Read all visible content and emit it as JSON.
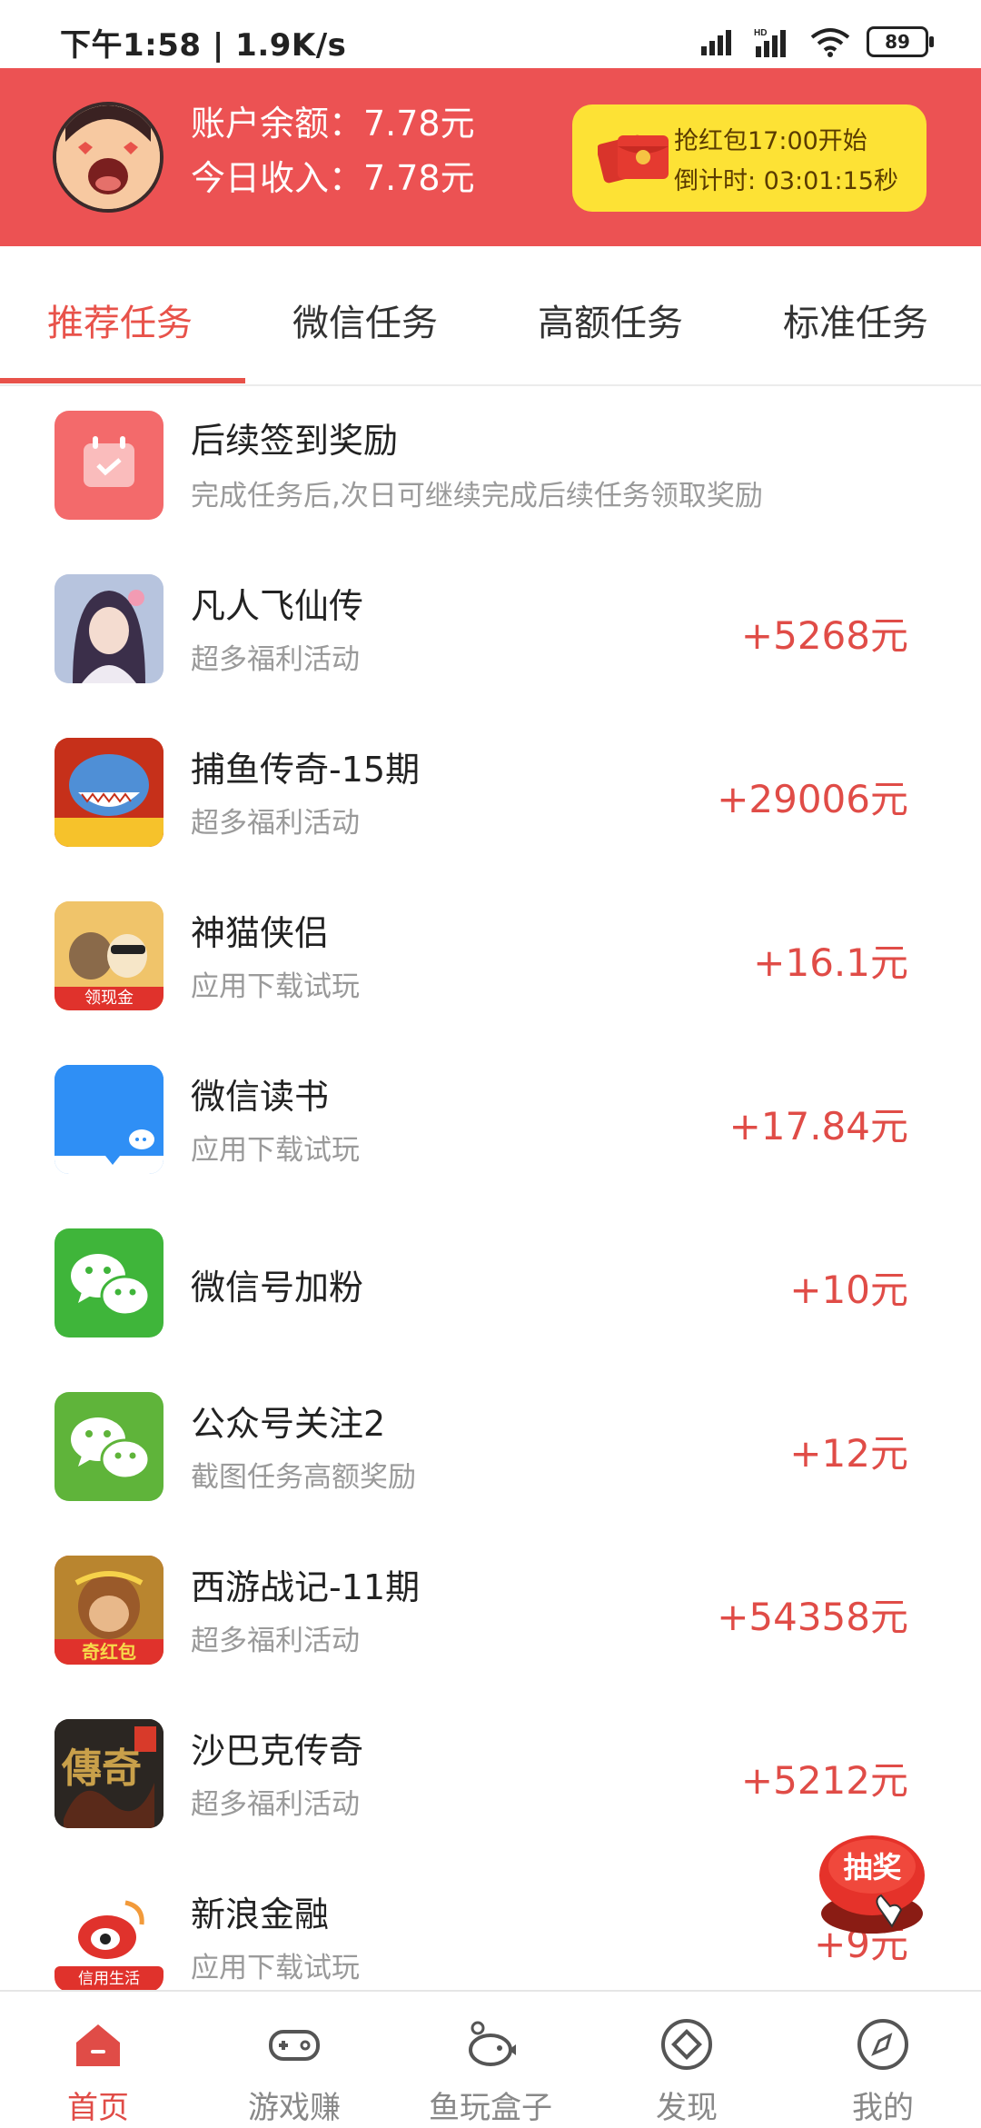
{
  "status_bar": {
    "time_speed": "下午1:58 | 1.9K/s",
    "battery": "89"
  },
  "header": {
    "balance": "账户余额：7.78元",
    "income": "今日收入：7.78元",
    "redpacket": {
      "start": "抢红包17:00开始",
      "countdown": "倒计时: 03:01:15秒"
    }
  },
  "tabs": [
    {
      "label": "推荐任务",
      "active": true
    },
    {
      "label": "微信任务"
    },
    {
      "label": "高额任务"
    },
    {
      "label": "标准任务"
    }
  ],
  "tasks": [
    {
      "title": "后续签到奖励",
      "subtitle": "完成任务后,次日可继续完成后续任务领取奖励",
      "reward": "",
      "icon": "calendar-check-icon"
    },
    {
      "title": "凡人飞仙传",
      "subtitle": "超多福利活动",
      "reward": "+5268元",
      "icon": "game-portrait-icon"
    },
    {
      "title": "捕鱼传奇-15期",
      "subtitle": "超多福利活动",
      "reward": "+29006元",
      "icon": "shark-game-icon"
    },
    {
      "title": "神猫侠侣",
      "subtitle": "应用下载试玩",
      "reward": "+16.1元",
      "icon": "cat-hero-icon",
      "badge": "领现金"
    },
    {
      "title": "微信读书",
      "subtitle": "应用下载试玩",
      "reward": "+17.84元",
      "icon": "wechat-read-icon"
    },
    {
      "title": "微信号加粉",
      "subtitle": "",
      "reward": "+10元",
      "icon": "wechat-icon"
    },
    {
      "title": "公众号关注2",
      "subtitle": "截图任务高额奖励",
      "reward": "+12元",
      "icon": "wechat-icon"
    },
    {
      "title": "西游战记-11期",
      "subtitle": "超多福利活动",
      "reward": "+54358元",
      "icon": "monkey-king-icon",
      "badge": "奇红包"
    },
    {
      "title": "沙巴克传奇",
      "subtitle": "超多福利活动",
      "reward": "+5212元",
      "icon": "legend-game-icon",
      "badge": "傳奇"
    },
    {
      "title": "新浪金融",
      "subtitle": "应用下载试玩",
      "reward": "+9元",
      "icon": "weibo-icon",
      "badge": "信用生活"
    }
  ],
  "floating": {
    "label": "抽奖"
  },
  "bottom_nav": [
    {
      "label": "首页",
      "icon": "home-icon",
      "active": true
    },
    {
      "label": "游戏赚",
      "icon": "gamepad-icon"
    },
    {
      "label": "鱼玩盒子",
      "icon": "fish-box-icon"
    },
    {
      "label": "发现",
      "icon": "discover-icon"
    },
    {
      "label": "我的",
      "icon": "compass-icon"
    }
  ],
  "colors": {
    "header_red": "#ec5253",
    "accent_red": "#e04c47",
    "yellow_card": "#fde235",
    "wechat_green": "#3fb53a"
  }
}
